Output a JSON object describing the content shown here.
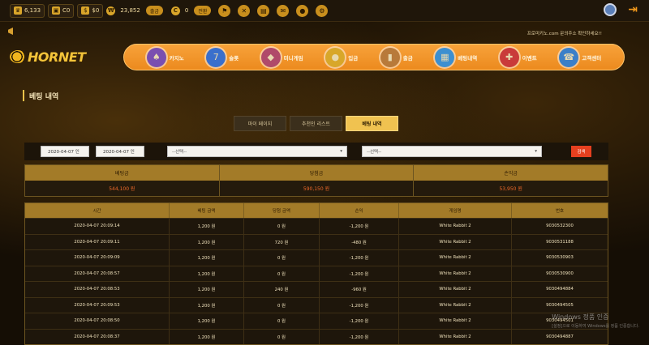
{
  "topbar": {
    "stat1": {
      "icon": "crown-icon",
      "value": "6,133"
    },
    "stat2": {
      "icon": "chest-icon",
      "value": "C0"
    },
    "stat3": {
      "icon": "dollar-icon",
      "value": "$0"
    },
    "money": {
      "value": "23,852",
      "label": "출금"
    },
    "comp": {
      "value": "0",
      "label": "전환"
    }
  },
  "header": {
    "notice": "프로미키노.com 문의주소 확인하세요!!",
    "logo": "HORNET"
  },
  "nav": [
    {
      "label": "카지노",
      "icon": "casino-icon",
      "color": "#7a4fb0"
    },
    {
      "label": "슬롯",
      "icon": "slot-icon",
      "color": "#3a6fcc"
    },
    {
      "label": "미니게임",
      "icon": "minigame-icon",
      "color": "#b04a6a"
    },
    {
      "label": "입금",
      "icon": "deposit-icon",
      "color": "#d8a72a"
    },
    {
      "label": "출금",
      "icon": "withdraw-icon",
      "color": "#b87a3a"
    },
    {
      "label": "베팅내역",
      "icon": "history-icon",
      "color": "#3d8fd0"
    },
    {
      "label": "이벤트",
      "icon": "gift-icon",
      "color": "#c93a3a"
    },
    {
      "label": "고객센터",
      "icon": "support-icon",
      "color": "#3b7fc8"
    }
  ],
  "page": {
    "title": "베팅 내역"
  },
  "tabs": [
    {
      "label": "마이 페이지",
      "active": false
    },
    {
      "label": "추천인 리스트",
      "active": false
    },
    {
      "label": "베팅 내역",
      "active": true
    }
  ],
  "filters": {
    "date_from": "2020-04-07 인",
    "date_to": "2020-04-07 인",
    "select1": "--선택--",
    "select2": "--선택--",
    "search": "검색"
  },
  "summary": [
    {
      "label": "베팅금",
      "value": "544,100 원"
    },
    {
      "label": "당첨금",
      "value": "590,150 원"
    },
    {
      "label": "손익금",
      "value": "53,950 원"
    }
  ],
  "table": {
    "headers": [
      "시간",
      "베팅 금액",
      "당첨 금액",
      "손익",
      "게임명",
      "번호"
    ],
    "rows": [
      [
        "2020-04-07 20:09:14",
        "1,200 원",
        "0 원",
        "-1,200 원",
        "White Rabbit 2",
        "9030532300"
      ],
      [
        "2020-04-07 20:09:11",
        "1,200 원",
        "720 원",
        "-480 원",
        "White Rabbit 2",
        "9030531188"
      ],
      [
        "2020-04-07 20:09:09",
        "1,200 원",
        "0 원",
        "-1,200 원",
        "White Rabbit 2",
        "9030530903"
      ],
      [
        "2020-04-07 20:08:57",
        "1,200 원",
        "0 원",
        "-1,200 원",
        "White Rabbit 2",
        "9030530900"
      ],
      [
        "2020-04-07 20:08:53",
        "1,200 원",
        "240 원",
        "-960 원",
        "White Rabbit 2",
        "9030494884"
      ],
      [
        "2020-04-07 20:09:53",
        "1,200 원",
        "0 원",
        "-1,200 원",
        "White Rabbit 2",
        "9030494505"
      ],
      [
        "2020-04-07 20:08:50",
        "1,200 원",
        "0 원",
        "-1,200 원",
        "White Rabbit 2",
        "9030494501"
      ],
      [
        "2020-04-07 20:08:37",
        "1,200 원",
        "0 원",
        "-1,200 원",
        "White Rabbit 2",
        "9030494887"
      ]
    ]
  },
  "watermark": {
    "line1": "Windows 정품 인증",
    "line2": "[설정]으로 이동하여 Windows를 정품 인증합니다."
  }
}
